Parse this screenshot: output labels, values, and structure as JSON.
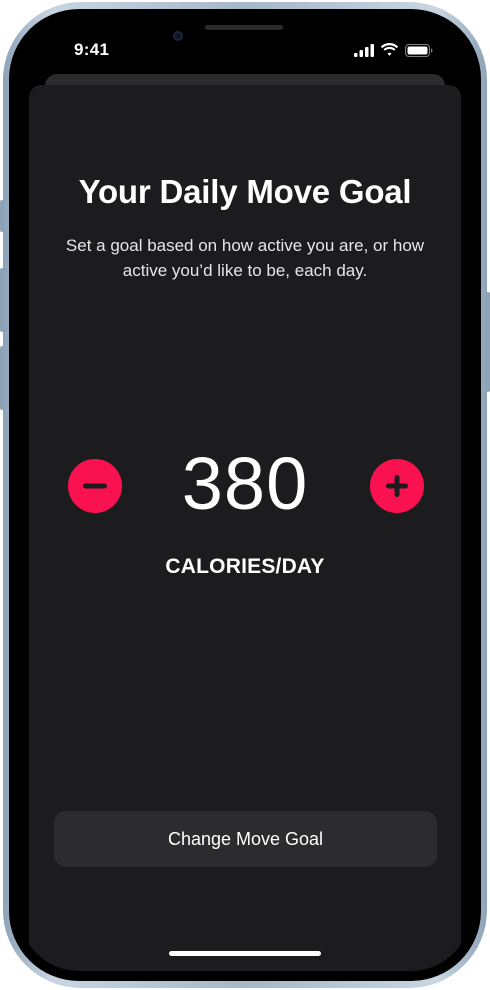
{
  "status_bar": {
    "time": "9:41",
    "icons": [
      "signal-bars-icon",
      "wifi-icon",
      "battery-icon"
    ]
  },
  "goal_sheet": {
    "title": "Your Daily Move Goal",
    "subtitle": "Set a goal based on how active you are, or how active you’d like to be, each day.",
    "goal_value": "380",
    "units": "CALORIES/DAY",
    "decrease_icon": "minus-icon",
    "increase_icon": "plus-icon",
    "primary_button_label": "Change Move Goal"
  },
  "colors": {
    "accent": "#fa114f",
    "sheet_background": "#1c1c1e",
    "button_background": "#2c2c2e",
    "text": "#ffffff"
  }
}
